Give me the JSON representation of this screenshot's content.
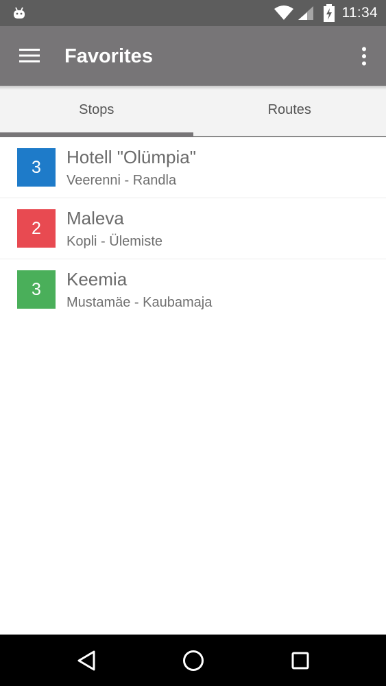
{
  "status_bar": {
    "time": "11:34",
    "left_icon": "android-icon",
    "wifi_icon": "wifi-icon",
    "signal_icon": "cell-signal-icon",
    "battery_icon": "battery-charging-icon"
  },
  "app_bar": {
    "title": "Favorites",
    "menu_icon": "menu-icon",
    "overflow_icon": "more-vert-icon",
    "color": "#777577"
  },
  "tabs": [
    {
      "label": "Stops",
      "active": true
    },
    {
      "label": "Routes",
      "active": false
    }
  ],
  "stops": [
    {
      "number": "3",
      "name": "Hotell \"Olümpia\"",
      "route": "Veerenni - Randla",
      "color": "#1e7bc9"
    },
    {
      "number": "2",
      "name": "Maleva",
      "route": "Kopli - Ülemiste",
      "color": "#e84a51"
    },
    {
      "number": "3",
      "name": "Keemia",
      "route": "Mustamäe - Kaubamaja",
      "color": "#4aaf5a"
    }
  ],
  "nav_bar": {
    "back_icon": "back-triangle-icon",
    "home_icon": "home-circle-icon",
    "recents_icon": "recents-square-icon"
  }
}
